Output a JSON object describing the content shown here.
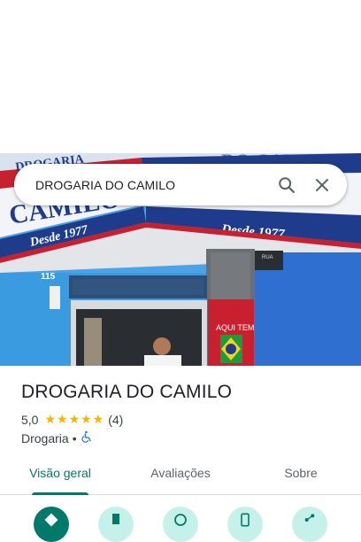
{
  "search": {
    "query": "DROGARIA DO CAMILO"
  },
  "photo": {
    "sign_left": "CAMILO",
    "sign_top_left": "DROGARIA",
    "sign_since_left": "Desde 1977",
    "sign_since_right": "Desde 1977",
    "sign_right": "DO CAMILO",
    "door_number": "115",
    "banner_text": "AQUI TEM",
    "plate_text": "RUA"
  },
  "place": {
    "name": "DROGARIA DO CAMILO",
    "rating": "5,0",
    "stars": "★★★★★",
    "review_count": "(4)",
    "category": "Drogaria",
    "separator": "•"
  },
  "tabs": [
    {
      "label": "Visão geral",
      "active": true
    },
    {
      "label": "Avaliações",
      "active": false
    },
    {
      "label": "Sobre",
      "active": false
    }
  ],
  "icons": {
    "search": "search-icon",
    "close": "close-icon",
    "accessible": "wheelchair-icon"
  },
  "colors": {
    "accent": "#00796b",
    "star": "#f4b400",
    "accessible": "#1a73e8",
    "action_bg": "#c6f1ea"
  }
}
